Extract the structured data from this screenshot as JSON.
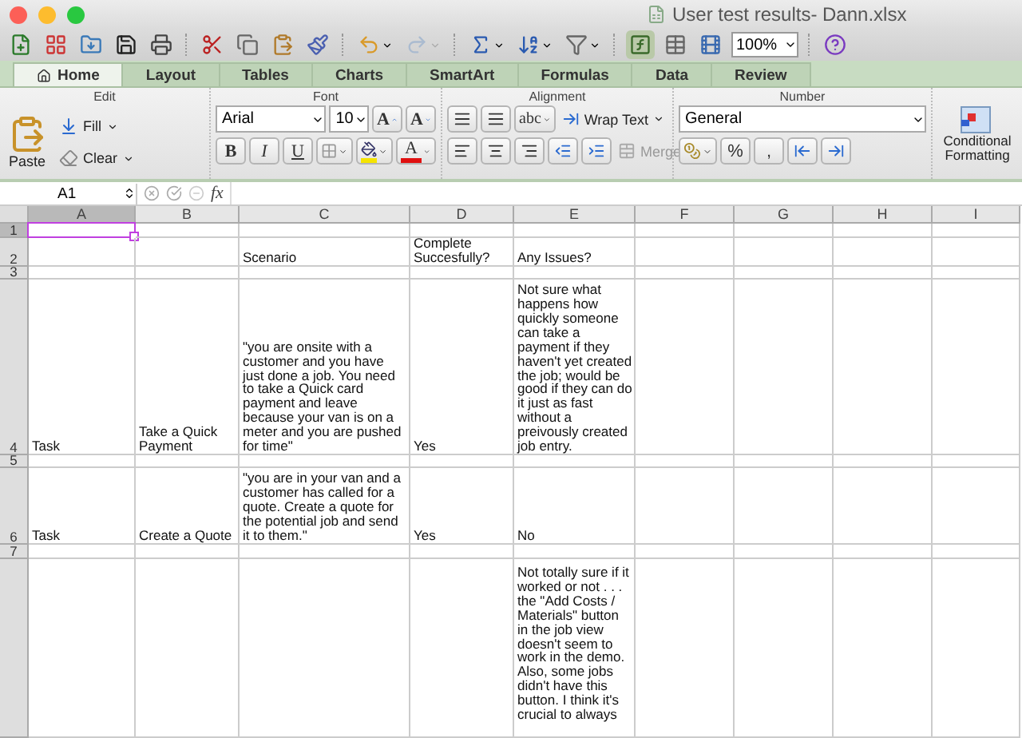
{
  "window": {
    "title": "User test results- Dann.xlsx"
  },
  "toolbar": {
    "zoom": "100%"
  },
  "tabs": [
    {
      "label": "Home",
      "selected": true
    },
    {
      "label": "Layout",
      "selected": false
    },
    {
      "label": "Tables",
      "selected": false
    },
    {
      "label": "Charts",
      "selected": false
    },
    {
      "label": "SmartArt",
      "selected": false
    },
    {
      "label": "Formulas",
      "selected": false
    },
    {
      "label": "Data",
      "selected": false
    },
    {
      "label": "Review",
      "selected": false
    }
  ],
  "ribbon": {
    "groups": [
      "Edit",
      "Font",
      "Alignment",
      "Number"
    ],
    "edit": {
      "paste": "Paste",
      "fill": "Fill",
      "clear": "Clear"
    },
    "font": {
      "name": "Arial",
      "size": "10",
      "grow": "A",
      "shrink": "A",
      "styles": [
        "B",
        "I",
        "U"
      ],
      "color_letter": "A"
    },
    "alignment": {
      "orientation": "abc",
      "wrap": "Wrap Text",
      "merge": {
        "label": "Merge",
        "disabled": true
      }
    },
    "number": {
      "format": "General",
      "percent": "%",
      "comma": ","
    },
    "conditional": "Conditional Formatting"
  },
  "formula_bar": {
    "cell": "A1",
    "fx": "fx"
  },
  "sheet": {
    "columns": [
      {
        "label": "A",
        "selected": true
      },
      {
        "label": "B",
        "selected": false
      },
      {
        "label": "C",
        "selected": false
      },
      {
        "label": "D",
        "selected": false
      },
      {
        "label": "E",
        "selected": false
      },
      {
        "label": "F",
        "selected": false
      },
      {
        "label": "G",
        "selected": false
      },
      {
        "label": "H",
        "selected": false
      },
      {
        "label": "I",
        "selected": false
      }
    ],
    "rows": [
      {
        "number": "1",
        "selected": true,
        "cells": []
      },
      {
        "number": "2",
        "selected": false,
        "cells": [
          null,
          null,
          "Scenario",
          "Complete Succesfully?",
          "Any Issues?"
        ]
      },
      {
        "number": "3",
        "selected": false,
        "cells": []
      },
      {
        "number": "4",
        "selected": false,
        "cells": [
          "Task",
          "Take a Quick Payment",
          "\"you are onsite with a customer and you have just done a job. You need to take a Quick card payment and leave because your van is on a meter and you are pushed for time\"",
          "Yes",
          "Not sure what happens how quickly someone can take a payment if they haven't yet created the job; would be good if they can do it just as fast without a preivously created job entry."
        ]
      },
      {
        "number": "5",
        "selected": false,
        "cells": []
      },
      {
        "number": "6",
        "selected": false,
        "cells": [
          "Task",
          "Create a Quote",
          "\"you are in your van and a customer has called for a quote. Create a quote for the potential job and send it to them.\"",
          "Yes",
          "No"
        ]
      },
      {
        "number": "7",
        "selected": false,
        "cells": []
      },
      {
        "selected": false,
        "cells": [
          null,
          null,
          null,
          null,
          "Not totally sure if it worked or not . . . the \"Add Costs / Materials\" button in the job view doesn't seem to work in the demo. Also, some jobs didn't have this button. I think it's crucial to always"
        ]
      }
    ]
  }
}
